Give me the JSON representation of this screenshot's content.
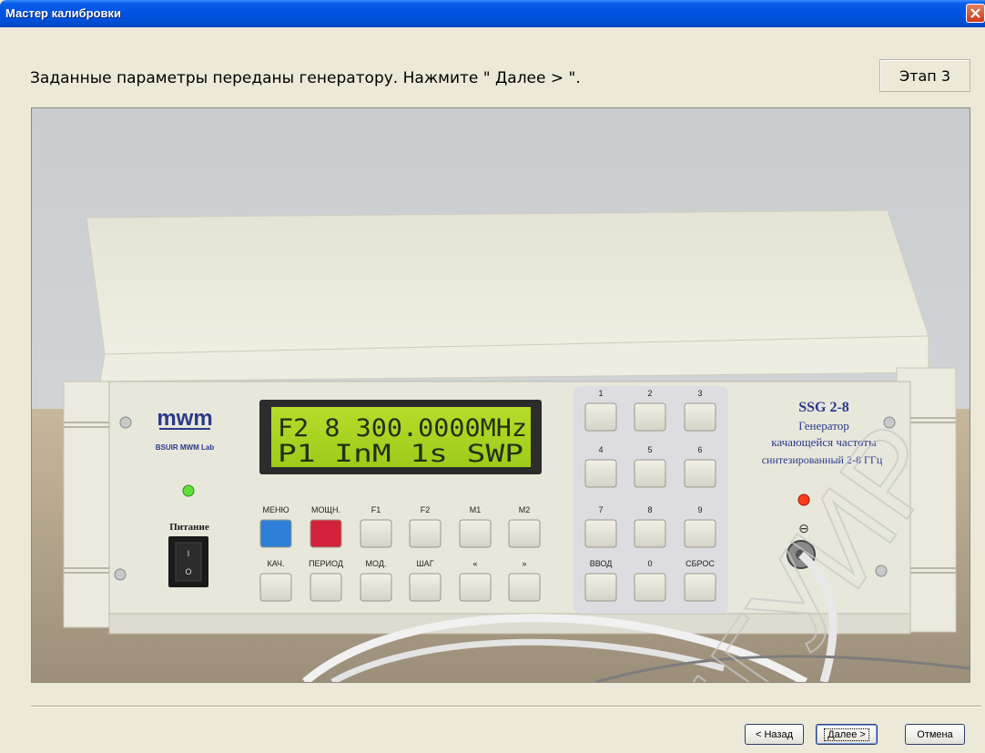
{
  "window": {
    "title": "Мастер калибровки"
  },
  "header": {
    "instruction": "Заданные параметры переданы генератору. Нажмите \" Далее > \".",
    "stage": "Этап 3"
  },
  "device": {
    "logo": "mwm",
    "lab": "BSUIR MWM Lab",
    "power_label": "Питание",
    "lcd_line1": "F2 8 300.0000MHz",
    "lcd_line2": "P1  InM  1s SWP",
    "model": "SSG 2-8",
    "desc1": "Генератор",
    "desc2": "качающейся частоты",
    "desc3": "синтезированный 2-8 ГГц",
    "row1": [
      "МЕНЮ",
      "МОЩН.",
      "F1",
      "F2",
      "M1",
      "M2"
    ],
    "row2": [
      "КАЧ.",
      "ПЕРИОД",
      "МОД.",
      "ШАГ",
      "«",
      "»"
    ],
    "keypad": [
      "1",
      "2",
      "3",
      "4",
      "5",
      "6",
      "7",
      "8",
      "9",
      "ВВОД",
      "0",
      "СБРОС"
    ],
    "watermark": "БГУИР"
  },
  "footer": {
    "back": "< Назад",
    "next": "Далее >",
    "cancel": "Отмена"
  },
  "colors": {
    "titlebar": "#0054e3",
    "lcd": "#a9d41f",
    "menu_button": "#2f7fd6",
    "power_button": "#d4213a"
  }
}
